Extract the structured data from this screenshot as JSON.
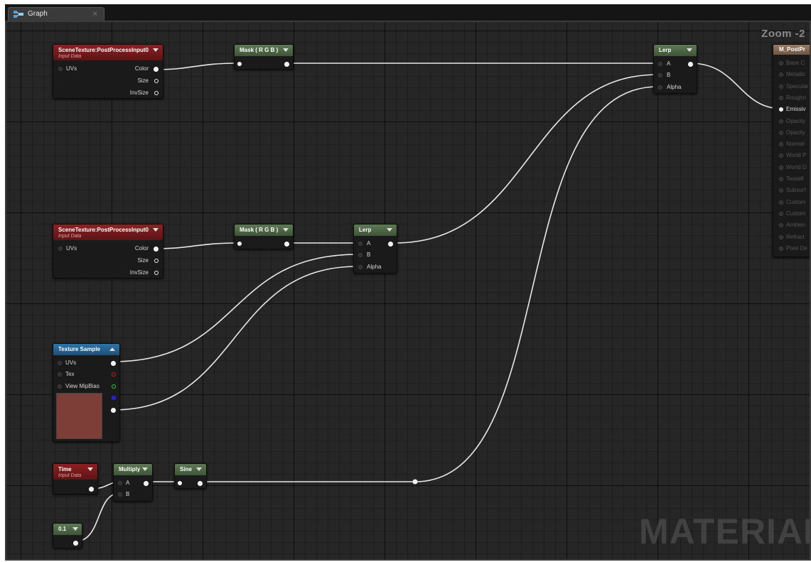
{
  "tab": {
    "label": "Graph",
    "close": "×",
    "icon": "graph-icon"
  },
  "zoom": "Zoom -2",
  "watermark": "MATERIAL",
  "scene1": {
    "title": "SceneTexture:PostProcessInput0",
    "subtitle": "Input Data",
    "in_uvs": "UVs",
    "out_color": "Color",
    "out_size": "Size",
    "out_invsize": "InvSize"
  },
  "scene2": {
    "title": "SceneTexture:PostProcessInput0",
    "subtitle": "Input Data",
    "in_uvs": "UVs",
    "out_color": "Color",
    "out_size": "Size",
    "out_invsize": "InvSize"
  },
  "mask1": {
    "title": "Mask ( R G B )"
  },
  "mask2": {
    "title": "Mask ( R G B )"
  },
  "lerp1": {
    "title": "Lerp",
    "in_a": "A",
    "in_b": "B",
    "in_alpha": "Alpha"
  },
  "lerp2": {
    "title": "Lerp",
    "in_a": "A",
    "in_b": "B",
    "in_alpha": "Alpha"
  },
  "texture": {
    "title": "Texture Sample",
    "in_uvs": "UVs",
    "in_tex": "Tex",
    "in_mip": "View MipBias",
    "preview_color": "#7c3e36"
  },
  "time": {
    "title": "Time",
    "subtitle": "Input Data"
  },
  "multiply": {
    "title": "Multiply",
    "in_a": "A",
    "in_b": "B"
  },
  "sine": {
    "title": "Sine"
  },
  "const": {
    "title": "0.1"
  },
  "output": {
    "title": "M_PostPr",
    "pins": [
      "Base C",
      "Metallic",
      "Specular",
      "Roughn",
      "Emissiv",
      "Opacity",
      "Opacity",
      "Normal",
      "World P",
      "World D",
      "Tessell",
      "Subsurf",
      "Custom",
      "Custom",
      "Ambien",
      "Refract",
      "Pixel De"
    ],
    "active_pin": "Emissiv"
  }
}
